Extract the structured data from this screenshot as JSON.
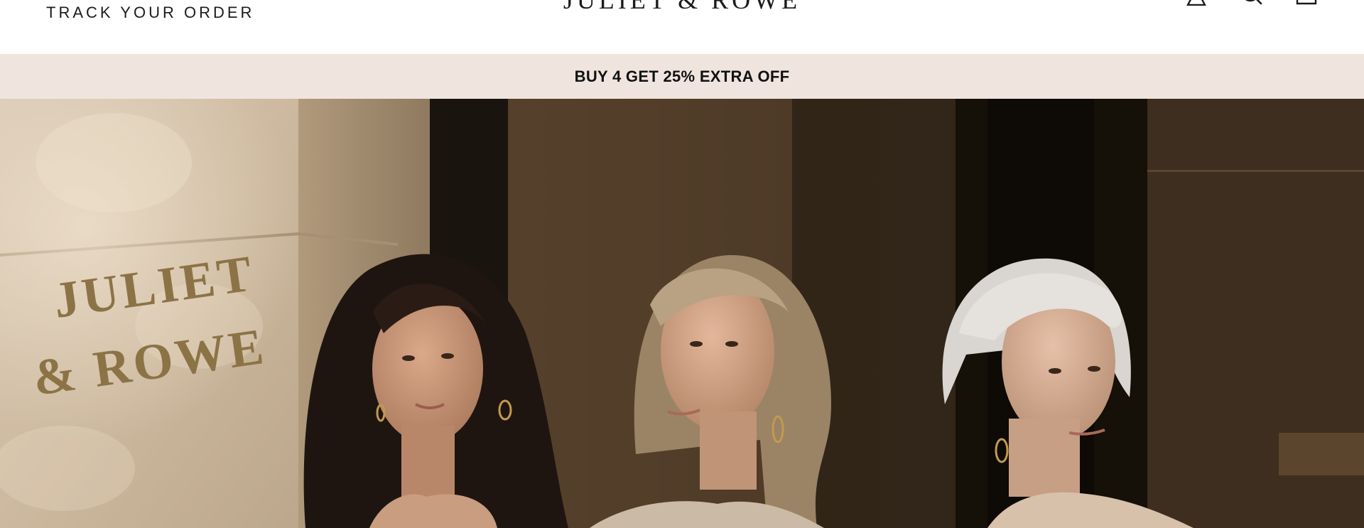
{
  "header": {
    "track_order_label": "TRACK YOUR ORDER",
    "logo_text": "JULIET & ROWE",
    "icons": [
      "account-icon",
      "search-icon",
      "cart-icon"
    ]
  },
  "announcement": {
    "text": "BUY 4 GET 25% EXTRA OFF"
  },
  "hero": {
    "sign_line1": "JULIET",
    "sign_line2": "& ROWE"
  },
  "colors": {
    "announcement_bg": "#efe5de",
    "text": "#111111",
    "stone": "#d9c9b6",
    "storefront": "#3a2c1e"
  }
}
